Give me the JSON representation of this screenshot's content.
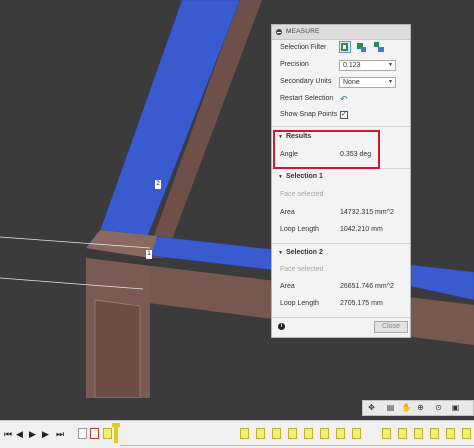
{
  "measure_panel": {
    "title": "MEASURE",
    "selection_filter_label": "Selection Filter",
    "precision_label": "Precision",
    "precision_value": "0.123",
    "secondary_units_label": "Secondary Units",
    "secondary_units_value": "None",
    "restart_selection_label": "Restart Selection",
    "show_snap_points_label": "Show Snap Points",
    "show_snap_points_checked": true,
    "results": {
      "heading": "Results",
      "angle_label": "Angle",
      "angle_value": "0.353 deg"
    },
    "selection1": {
      "heading": "Selection 1",
      "type": "Face selected",
      "area_label": "Area",
      "area_value": "14732.315 mm^2",
      "loop_label": "Loop Length",
      "loop_value": "1042.210 mm"
    },
    "selection2": {
      "heading": "Selection 2",
      "type": "Face selected",
      "area_label": "Area",
      "area_value": "26651.746 mm^2",
      "loop_label": "Loop Length",
      "loop_value": "2705.175 mm"
    },
    "close_label": "Close"
  },
  "viewport_badges": {
    "badge1": "1",
    "badge2": "2"
  },
  "colors": {
    "selected_face_blue": "#3a5bcf",
    "beam_brown": "#7a5a52",
    "highlight_red": "#d0192a",
    "timeline_yellow": "#f4f06a",
    "background": "#3b3b3b"
  },
  "icons": {
    "panel_title": "collapse-dot-icon",
    "selection_filters": [
      "select-body-icon",
      "select-face-icon",
      "select-edge-icon"
    ],
    "restart": "restart-arrow-icon",
    "info": "info-icon",
    "nav": [
      "orbit-icon",
      "look-at-icon",
      "pan-hand-icon",
      "zoom-icon",
      "zoom-window-icon",
      "display-settings-icon"
    ],
    "timeline": [
      "skip-start-icon",
      "step-back-icon",
      "play-icon",
      "step-forward-icon",
      "skip-end-icon"
    ]
  }
}
